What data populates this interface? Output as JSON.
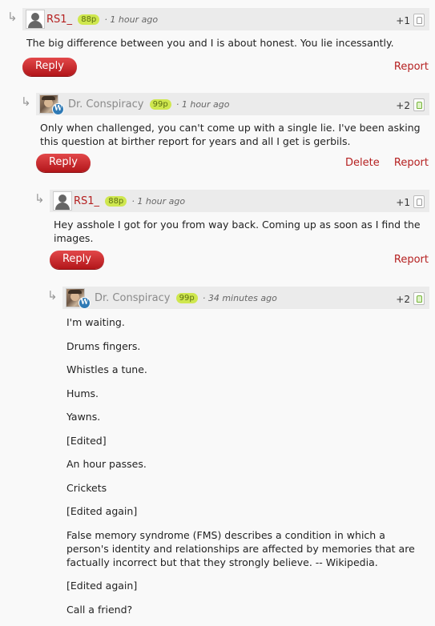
{
  "comments": [
    {
      "author": "RS1_",
      "points": "88p",
      "time": "· 1 hour ago",
      "votes": "+1",
      "paragraphs": [
        "The big difference between you and I is about honest. You lie incessantly."
      ],
      "reply_label": "Reply",
      "report_label": "Report"
    },
    {
      "author": "Dr. Conspiracy",
      "points": "99p",
      "time": "· 1 hour ago",
      "votes": "+2",
      "paragraphs": [
        "Only when challenged, you can't come up with a single lie. I've been asking this question at birther report for years and all I get is gerbils."
      ],
      "reply_label": "Reply",
      "delete_label": "Delete",
      "report_label": "Report"
    },
    {
      "author": "RS1_",
      "points": "88p",
      "time": "· 1 hour ago",
      "votes": "+1",
      "paragraphs": [
        "Hey asshole I got for you from way back. Coming up as soon as I find the images."
      ],
      "reply_label": "Reply",
      "report_label": "Report"
    },
    {
      "author": "Dr. Conspiracy",
      "points": "99p",
      "time": "· 34 minutes ago",
      "votes": "+2",
      "paragraphs": [
        "I'm waiting.",
        "Drums fingers.",
        "Whistles a tune.",
        "Hums.",
        "Yawns.",
        "[Edited]",
        "An hour passes.",
        "Crickets",
        "[Edited again]",
        "False memory syndrome (FMS) describes a condition in which a person's identity and relationships are affected by memories that are factually incorrect but that they strongly believe. -- Wikipedia.",
        "[Edited again]",
        "Call a friend?"
      ]
    }
  ],
  "icons": {
    "reply_arrow": "reply-arrow-icon",
    "wordpress_badge": "wordpress-icon",
    "thumbs_up": "thumbs-up-icon"
  }
}
